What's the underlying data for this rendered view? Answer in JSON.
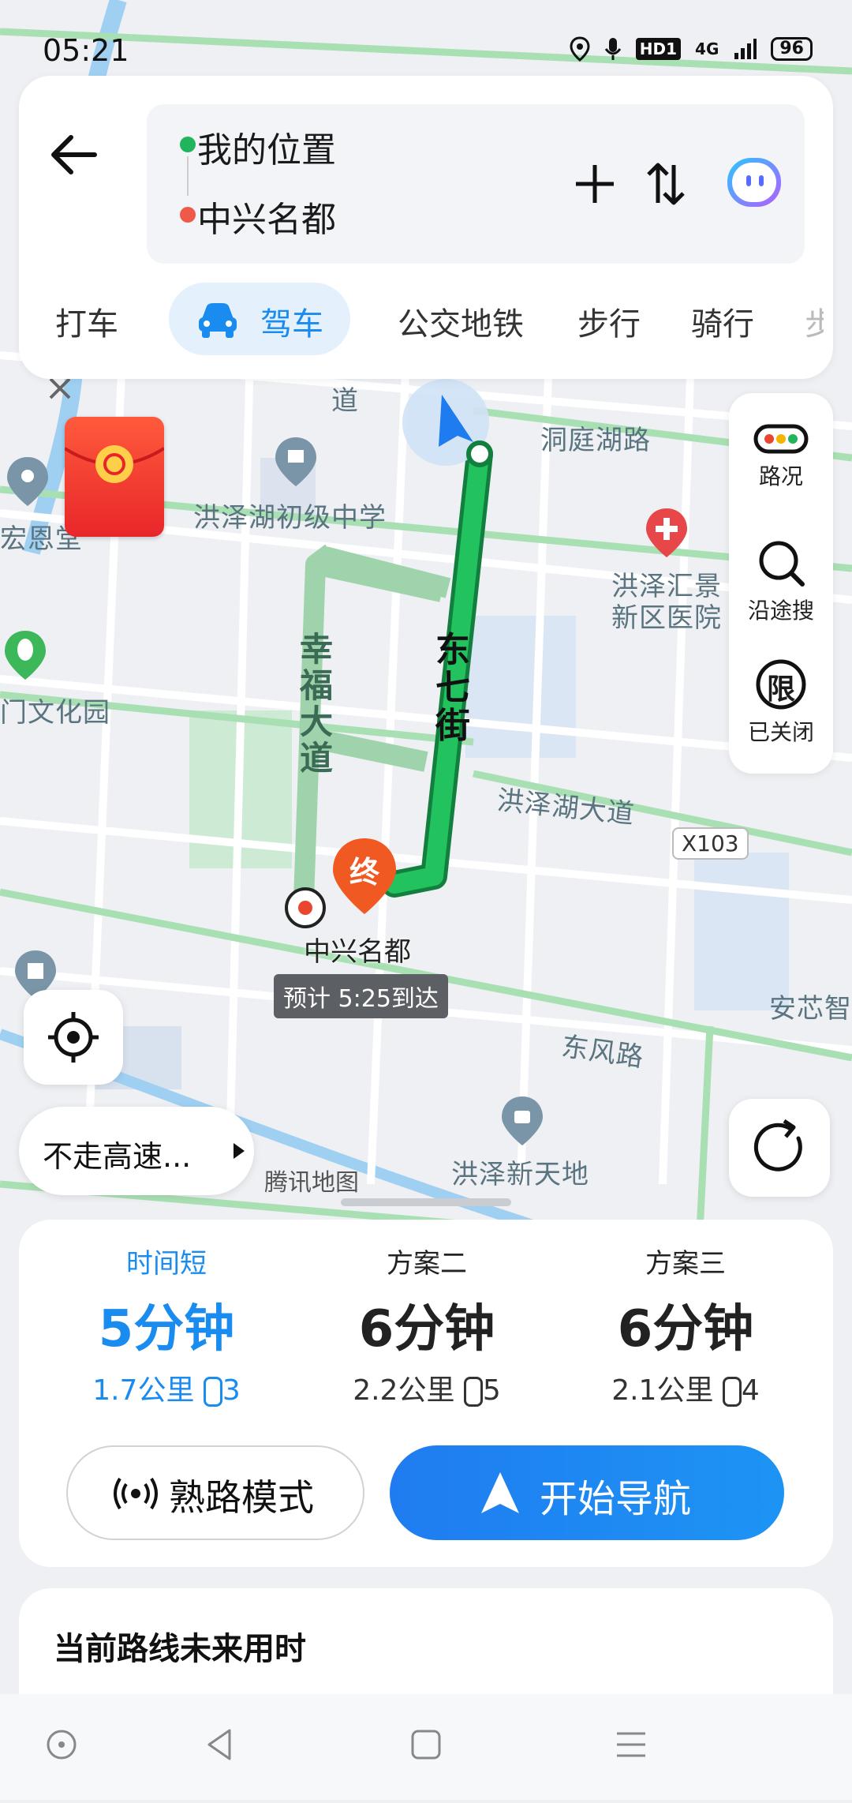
{
  "status": {
    "time": "05:21",
    "signal": "4G",
    "hd": "HD1",
    "battery": "96"
  },
  "route": {
    "origin": "我的位置",
    "destination": "中兴名都"
  },
  "modes": [
    "打车",
    "驾车",
    "公交地铁",
    "步行",
    "骑行",
    "步"
  ],
  "tools": {
    "traffic": "路况",
    "search_along": "沿途搜",
    "limit": "已关闭",
    "limit_icon_char": "限"
  },
  "map_labels": {
    "dongting": "洞庭湖路",
    "school": "洪泽湖初级中学",
    "hospital_line1": "洪泽汇景",
    "hospital_line2": "新区医院",
    "xingfu_1": "幸",
    "xingfu_2": "福",
    "xingfu_3": "大",
    "xingfu_4": "道",
    "dongqi_1": "东",
    "dongqi_2": "七",
    "dongqi_3": "街",
    "hongzehu_ave": "洪泽湖大道",
    "x103": "X103",
    "dongfeng": "东风路",
    "xintiandi": "洪泽新天地",
    "tencent": "腾讯地图",
    "anxin": "安芯智",
    "culture_park": "门文化园",
    "hong_en": "宏恩堂",
    "dao_top": "道",
    "zhongxing": "中兴名都",
    "eta": "预计 5:25到达",
    "end_marker": "终"
  },
  "avoid_highway": "不走高速...",
  "plans": [
    {
      "name": "时间短",
      "time": "5分钟",
      "distance": "1.7公里",
      "lights": "3"
    },
    {
      "name": "方案二",
      "time": "6分钟",
      "distance": "2.2公里",
      "lights": "5"
    },
    {
      "name": "方案三",
      "time": "6分钟",
      "distance": "2.1公里",
      "lights": "4"
    }
  ],
  "familiar_mode": "熟路模式",
  "start_navigation": "开始导航",
  "future_title": "当前路线未来用时",
  "colors": {
    "accent": "#1a8cf0",
    "route_green": "#1fb25a",
    "alt_route": "#9fd3ab",
    "destination": "#f05a22"
  }
}
